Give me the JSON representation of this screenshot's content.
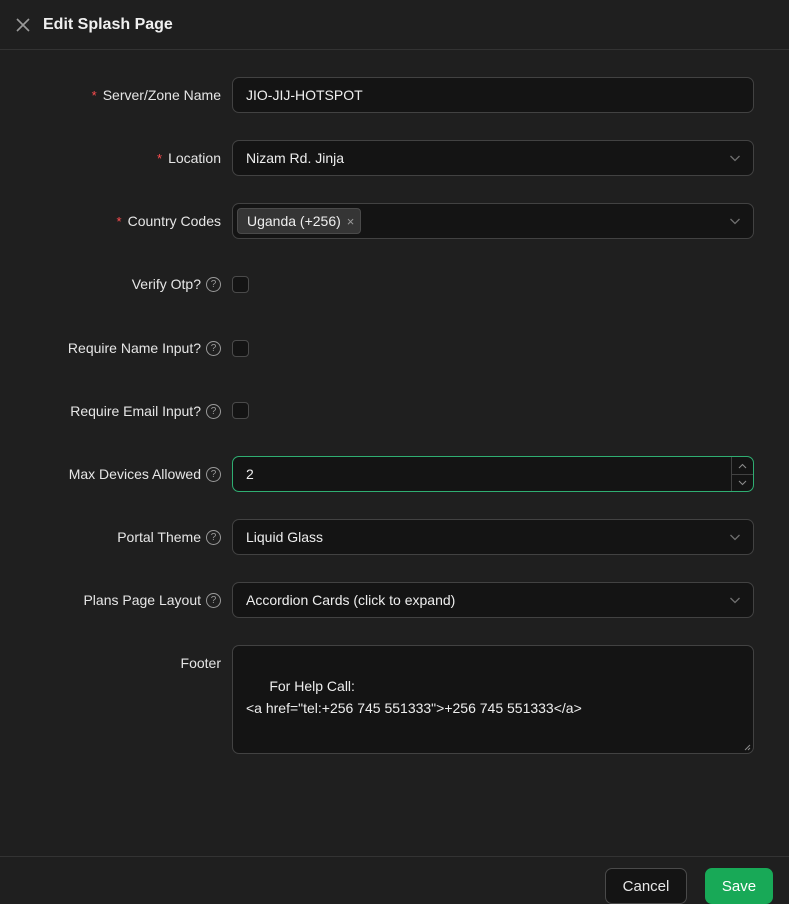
{
  "header": {
    "title": "Edit Splash Page"
  },
  "form": {
    "server_zone_name": {
      "label": "Server/Zone Name",
      "value": "JIO-JIJ-HOTSPOT",
      "required": true
    },
    "location": {
      "label": "Location",
      "value": "Nizam Rd. Jinja",
      "required": true
    },
    "country_codes": {
      "label": "Country Codes",
      "tags": [
        "Uganda (+256)"
      ],
      "required": true
    },
    "verify_otp": {
      "label": "Verify Otp?",
      "checked": false
    },
    "require_name": {
      "label": "Require Name Input?",
      "checked": false
    },
    "require_email": {
      "label": "Require Email Input?",
      "checked": false
    },
    "max_devices": {
      "label": "Max Devices Allowed",
      "value": "2"
    },
    "portal_theme": {
      "label": "Portal Theme",
      "value": "Liquid Glass"
    },
    "plans_layout": {
      "label": "Plans Page Layout",
      "value": "Accordion Cards (click to expand)"
    },
    "footer": {
      "label": "Footer",
      "value": "For Help Call:\n<a href=\"tel:+256 745 551333\">+256 745 551333</a>"
    }
  },
  "required_mark": "*",
  "help_glyph": "?",
  "tag_close_glyph": "×",
  "actions": {
    "cancel_label": "Cancel",
    "save_label": "Save"
  },
  "colors": {
    "accent": "#18a957",
    "required": "#ff4d4f",
    "focus_border": "#2fae72"
  }
}
